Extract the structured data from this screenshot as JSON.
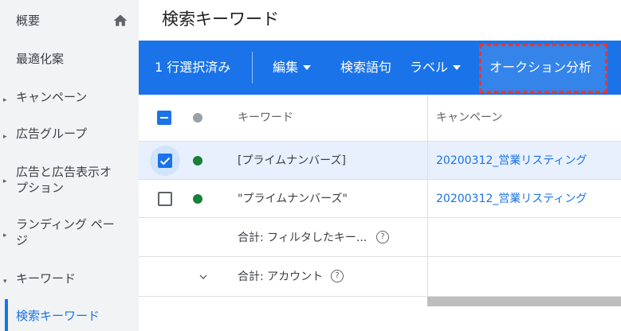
{
  "sidebar": {
    "items": [
      {
        "label": "概要",
        "caret": ""
      },
      {
        "label": "最適化案",
        "caret": ""
      },
      {
        "label": "キャンペーン",
        "caret": "▸"
      },
      {
        "label": "広告グループ",
        "caret": "▸"
      },
      {
        "label": "広告と広告表示オ",
        "label2": "プション",
        "caret": "▸"
      },
      {
        "label": "ランディング ペー",
        "label2": "ジ",
        "caret": "▸"
      },
      {
        "label": "キーワード",
        "caret": "▾"
      },
      {
        "label": "検索キーワード",
        "caret": ""
      }
    ],
    "home_icon": "home-icon"
  },
  "page": {
    "title": "検索キーワード"
  },
  "toolbar": {
    "selected_count": "1 行選択済み",
    "edit": "編集",
    "search_terms": "検索語句",
    "label": "ラベル",
    "auction_insights": "オークション分析",
    "accent_color": "#1a73e8",
    "highlight_color": "#e53935"
  },
  "table": {
    "headers": {
      "keyword": "キーワード",
      "campaign": "キャンペーン"
    },
    "rows": [
      {
        "keyword": "[プライムナンバーズ]",
        "campaign": "20200312_営業リスティング",
        "checked": true,
        "status": "green"
      },
      {
        "keyword": "\"プライムナンバーズ\"",
        "campaign": "20200312_営業リスティング",
        "checked": false,
        "status": "green"
      }
    ],
    "totals": {
      "filtered": "合計: フィルタしたキー...",
      "account": "合計: アカウント"
    }
  }
}
